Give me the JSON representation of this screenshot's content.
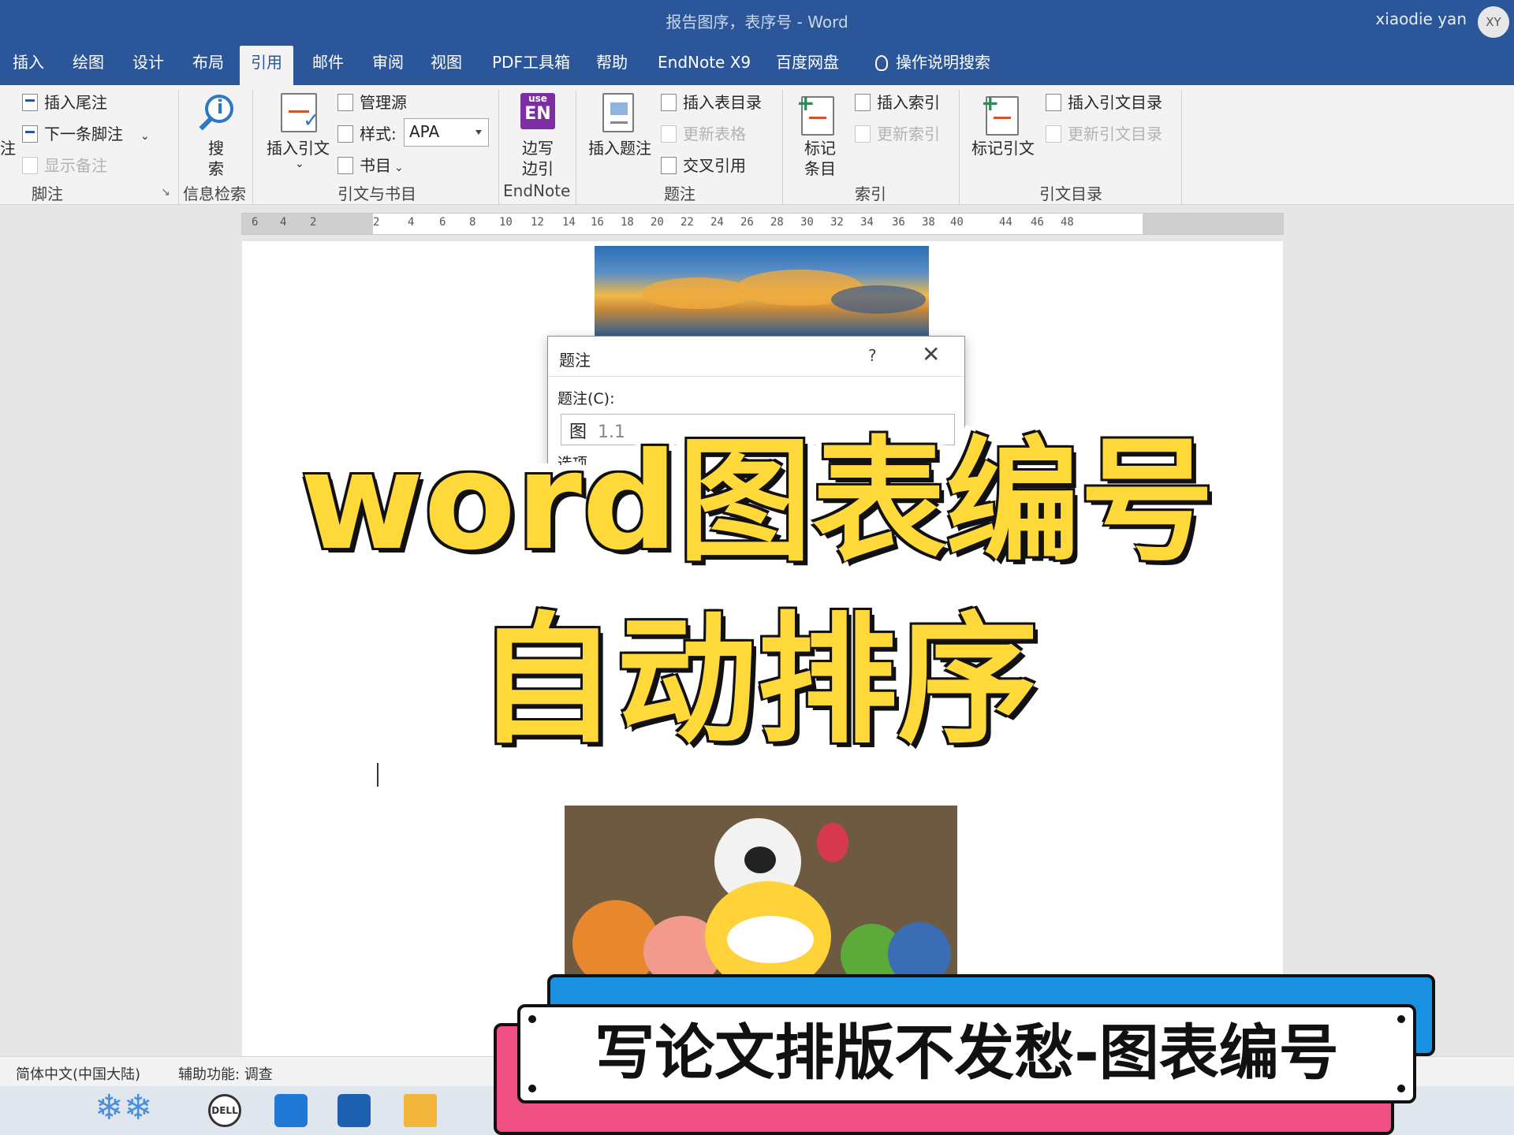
{
  "window": {
    "title": "报告图序，表序号 - Word",
    "user_name": "xiaodie yan",
    "avatar_initials": "XY"
  },
  "tabs": [
    {
      "label": "插入"
    },
    {
      "label": "绘图"
    },
    {
      "label": "设计"
    },
    {
      "label": "布局"
    },
    {
      "label": "引用",
      "active": true
    },
    {
      "label": "邮件"
    },
    {
      "label": "审阅"
    },
    {
      "label": "视图"
    },
    {
      "label": "PDF工具箱"
    },
    {
      "label": "帮助"
    },
    {
      "label": "EndNote X9"
    },
    {
      "label": "百度网盘"
    }
  ],
  "tell_me": "操作说明搜索",
  "ribbon": {
    "footnotes": {
      "partial_label": "注",
      "insert_endnote": "插入尾注",
      "next_footnote": "下一条脚注",
      "show_notes": "显示备注",
      "group_label": "脚注"
    },
    "research": {
      "search_line1": "搜",
      "search_line2": "索",
      "group_label": "信息检索"
    },
    "citations": {
      "insert_citation": "插入引文",
      "manage_sources": "管理源",
      "style_label": "样式:",
      "style_value": "APA",
      "bibliography": "书目",
      "group_label": "引文与书目"
    },
    "endnote": {
      "logo_top": "use",
      "logo_main": "EN",
      "cite_line1": "边写",
      "cite_line2": "边引",
      "group_label": "EndNote"
    },
    "captions": {
      "insert_caption": "插入题注",
      "insert_table_of_figures": "插入表目录",
      "update_table": "更新表格",
      "cross_reference": "交叉引用",
      "group_label": "题注"
    },
    "index": {
      "mark_entry_line1": "标记",
      "mark_entry_line2": "条目",
      "insert_index": "插入索引",
      "update_index": "更新索引",
      "group_label": "索引"
    },
    "toa": {
      "mark_citation": "标记引文",
      "insert_toa": "插入引文目录",
      "update_toa": "更新引文目录",
      "group_label": "引文目录"
    }
  },
  "ruler_ticks": [
    "6",
    "4",
    "2",
    "2",
    "4",
    "6",
    "8",
    "10",
    "12",
    "14",
    "16",
    "18",
    "20",
    "22",
    "24",
    "26",
    "28",
    "30",
    "32",
    "34",
    "36",
    "38",
    "40",
    "44",
    "46",
    "48"
  ],
  "dialog": {
    "title": "题注",
    "help": "?",
    "close": "✕",
    "caption_label": "题注(C):",
    "caption_prefix": "图",
    "caption_number": "1.1",
    "options_label": "选项"
  },
  "overlay": {
    "headline_line1": "word图表编号",
    "headline_line2": "自动排序",
    "banner_text": "写论文排版不发愁-图表编号"
  },
  "statusbar": {
    "language": "简体中文(中国大陆)",
    "accessibility": "辅助功能: 调查"
  },
  "taskbar": {
    "dell_label": "DELL"
  },
  "colors": {
    "word_blue": "#2b579a",
    "headline_yellow": "#ffd83a",
    "banner_blue": "#1a90e0",
    "banner_pink": "#f04f83"
  }
}
